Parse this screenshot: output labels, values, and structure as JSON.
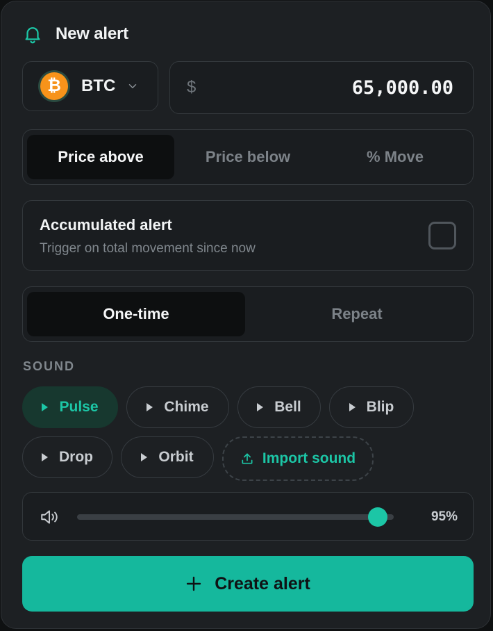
{
  "header": {
    "title": "New alert",
    "icon": "bell-icon"
  },
  "asset": {
    "symbol": "BTC",
    "logo_glyph": "₿"
  },
  "price": {
    "currency": "$",
    "value": "65,000.00"
  },
  "mode_tabs": [
    "Price above",
    "Price below",
    "% Move"
  ],
  "mode_selected": "Price above",
  "accumulated": {
    "title": "Accumulated alert",
    "subtitle": "Trigger on total movement since now",
    "checked": false
  },
  "frequency_tabs": [
    "One-time",
    "Repeat"
  ],
  "frequency_selected": "One-time",
  "sound": {
    "label": "SOUND",
    "options": [
      "Pulse",
      "Chime",
      "Bell",
      "Blip",
      "Drop",
      "Orbit"
    ],
    "selected": "Pulse",
    "import_label": "Import sound"
  },
  "volume": {
    "percent": 95,
    "label": "95%"
  },
  "create_label": "Create alert",
  "colors": {
    "accent": "#1cc6a6",
    "button": "#15b89d",
    "panel": "#1d2023",
    "coin": "#f7931a"
  }
}
